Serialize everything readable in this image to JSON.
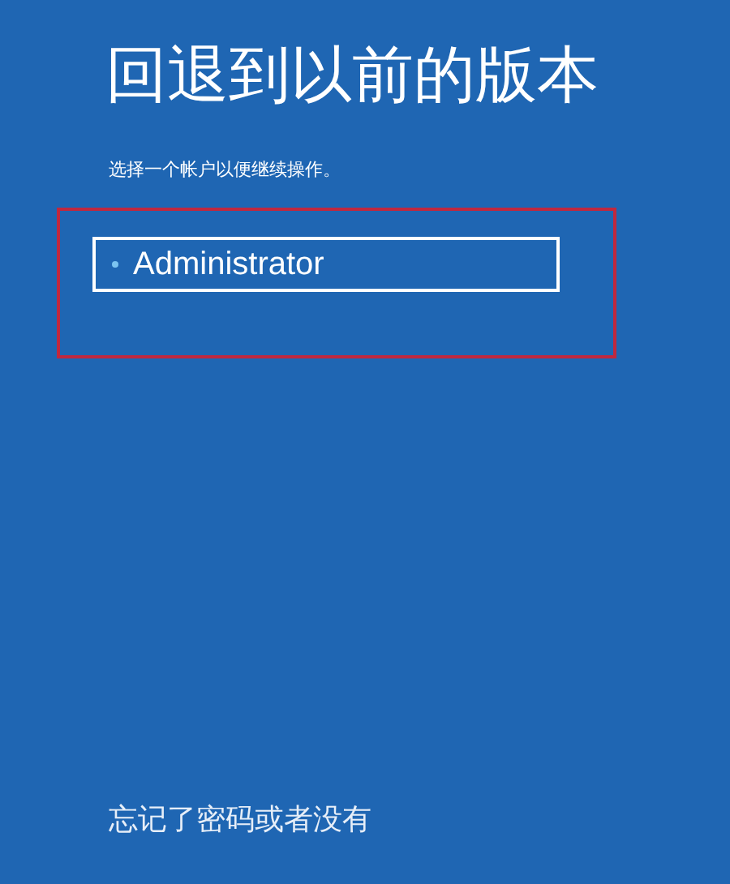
{
  "title": "回退到以前的版本",
  "subtitle": "选择一个帐户以便继续操作。",
  "accounts": [
    {
      "name": "Administrator",
      "highlighted": true
    }
  ],
  "footer_link": "忘记了密码或者没有"
}
